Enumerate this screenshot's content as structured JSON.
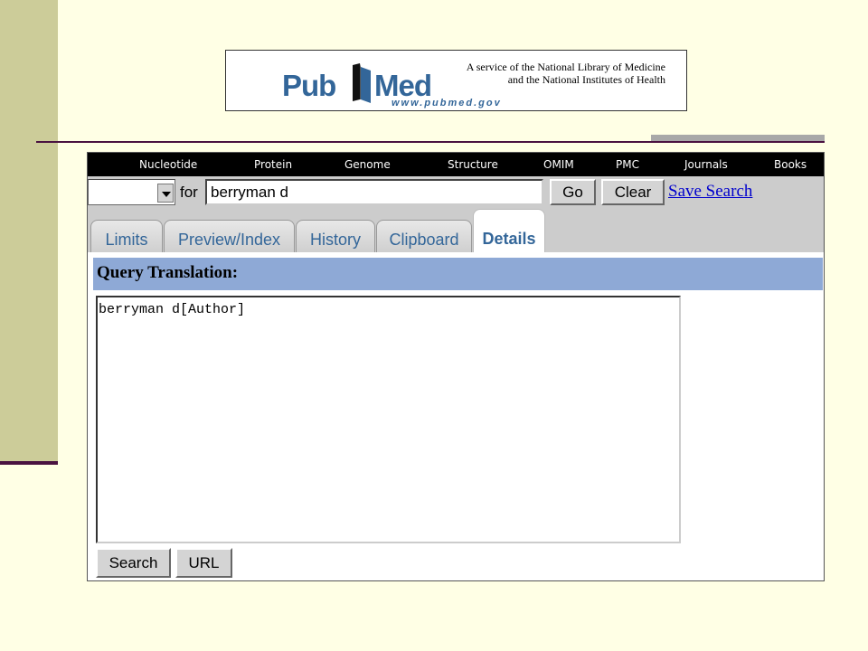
{
  "banner": {
    "logo_pub": "Pub",
    "logo_med": "Med",
    "logo_url": "www.pubmed.gov",
    "service_line1": "A service of the National Library of Medicine",
    "service_line2": "and the National Institutes of Health"
  },
  "nav": {
    "items": [
      "Nucleotide",
      "Protein",
      "Genome",
      "Structure",
      "OMIM",
      "PMC",
      "Journals",
      "Books"
    ]
  },
  "search": {
    "database_value": "",
    "for_label": "for",
    "term_value": "berryman d",
    "go_label": "Go",
    "clear_label": "Clear",
    "save_search_label": "Save Search"
  },
  "tabs": {
    "items": [
      {
        "label": "Limits",
        "active": false
      },
      {
        "label": "Preview/Index",
        "active": false
      },
      {
        "label": "History",
        "active": false
      },
      {
        "label": "Clipboard",
        "active": false
      },
      {
        "label": "Details",
        "active": true
      }
    ]
  },
  "details": {
    "heading": "Query Translation:",
    "query_text": "berryman d[Author]",
    "search_label": "Search",
    "url_label": "URL"
  },
  "colors": {
    "sidebar": "#cccc99",
    "accent_line": "#4a1240",
    "header_bar": "#8ea9d6",
    "link": "#0000cc",
    "logo_blue": "#336699"
  }
}
